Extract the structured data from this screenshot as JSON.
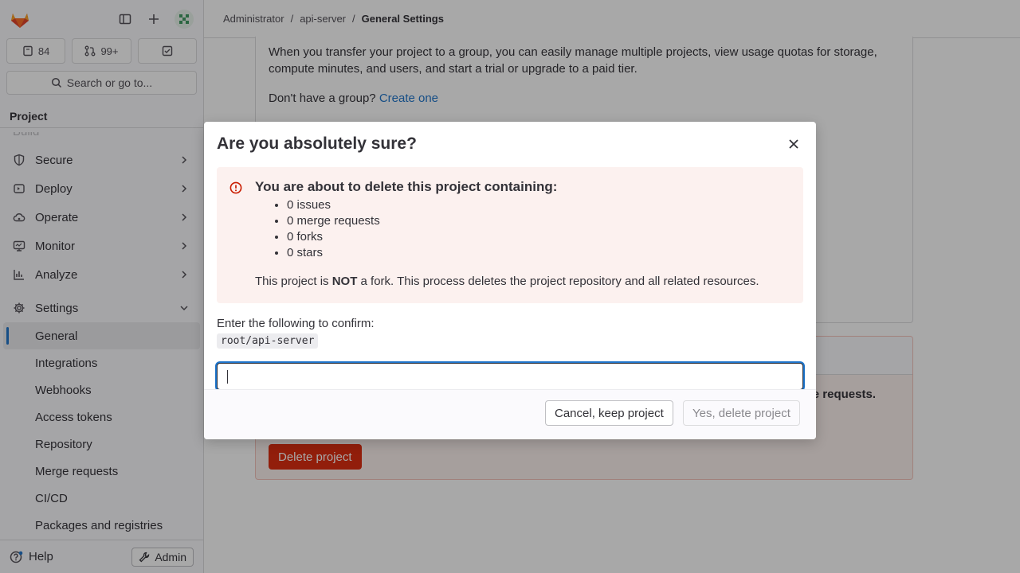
{
  "sidebar": {
    "counts": {
      "issues": "84",
      "merge_requests": "99+"
    },
    "search_label": "Search or go to...",
    "section_title": "Project",
    "partial_item": "Build",
    "nav": [
      {
        "label": "Secure",
        "icon": "shield-icon"
      },
      {
        "label": "Deploy",
        "icon": "deploy-icon"
      },
      {
        "label": "Operate",
        "icon": "cloud-icon"
      },
      {
        "label": "Monitor",
        "icon": "monitor-icon"
      },
      {
        "label": "Analyze",
        "icon": "chart-icon"
      }
    ],
    "settings": {
      "label": "Settings",
      "items": [
        "General",
        "Integrations",
        "Webhooks",
        "Access tokens",
        "Repository",
        "Merge requests",
        "CI/CD",
        "Packages and registries"
      ]
    },
    "help_label": "Help",
    "admin_label": "Admin"
  },
  "breadcrumb": [
    "Administrator",
    "api-server",
    "General Settings"
  ],
  "background": {
    "transfer_text": "When you transfer your project to a group, you can easily manage multiple projects, view usage quotas for storage, compute minutes, and users, and start a trial or upgrade to a paid tier.",
    "group_question": "Don't have a group?",
    "create_link": "Create one",
    "warning_tail": "e requests.",
    "delete_button": "Delete project"
  },
  "modal": {
    "title": "Are you absolutely sure?",
    "alert_title": "You are about to delete this project containing:",
    "items": [
      "0 issues",
      "0 merge requests",
      "0 forks",
      "0 stars"
    ],
    "note_prefix": "This project is ",
    "note_bold": "NOT",
    "note_suffix": " a fork. This process deletes the project repository and all related resources.",
    "confirm_label": "Enter the following to confirm:",
    "confirm_code": "root/api-server",
    "input_value": "",
    "cancel_label": "Cancel, keep project",
    "delete_label": "Yes, delete project"
  },
  "colors": {
    "accent": "#1f75cb",
    "danger": "#dd2b0e",
    "alert_bg": "#fcf1ef"
  }
}
